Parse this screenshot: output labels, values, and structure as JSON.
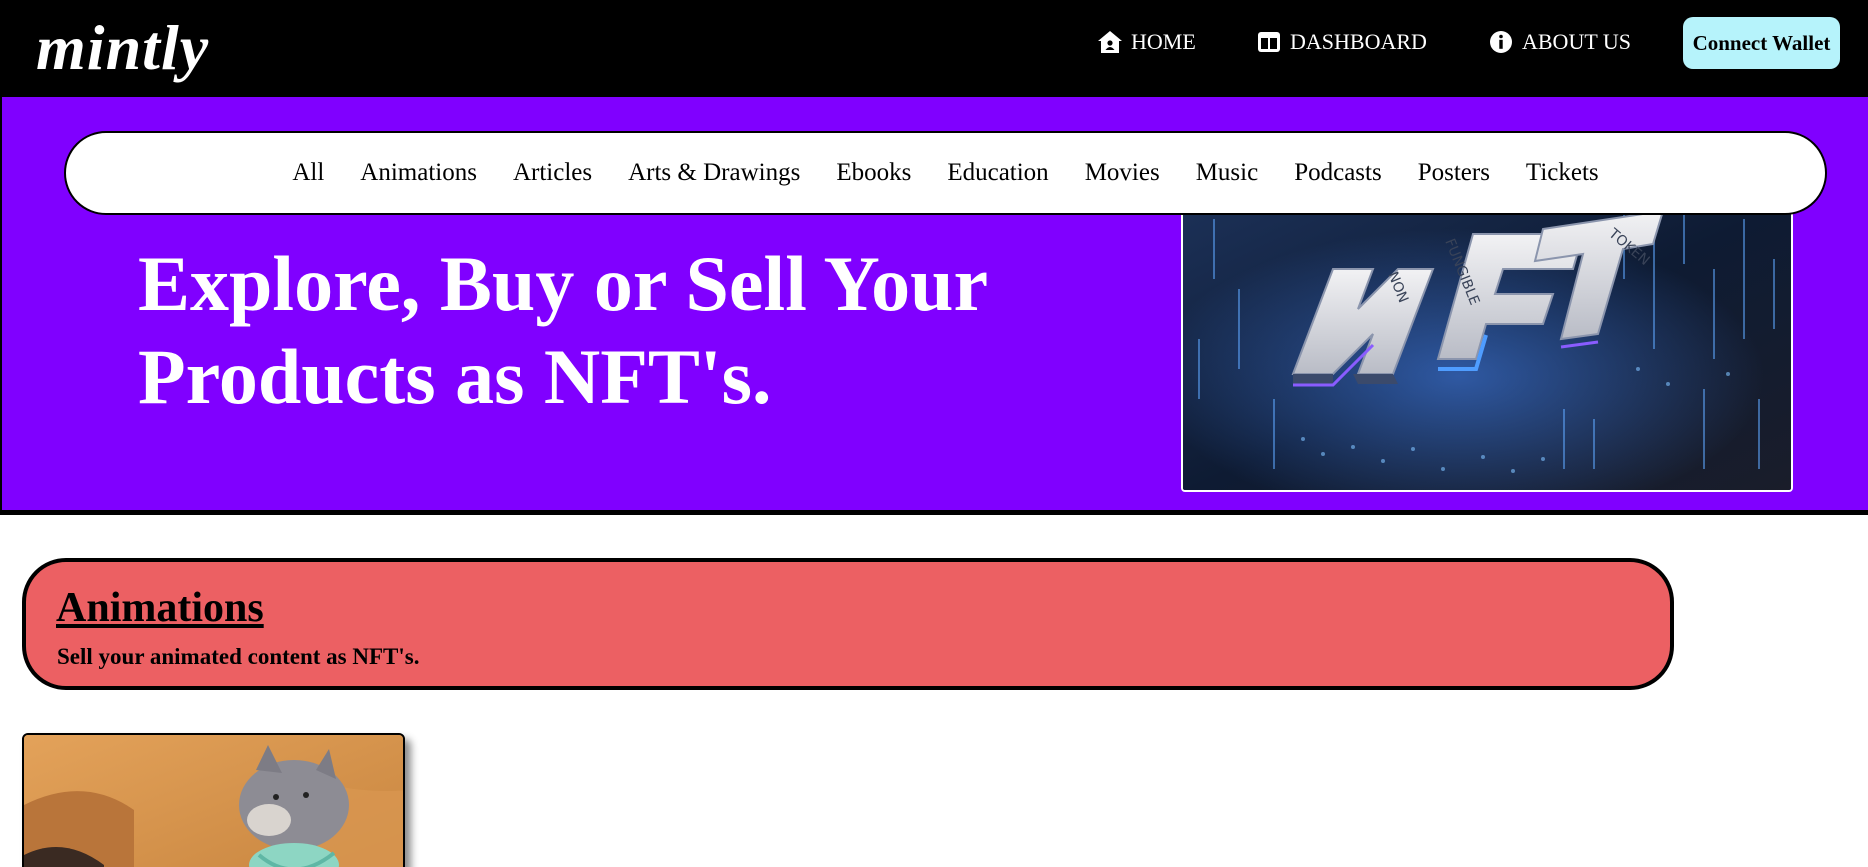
{
  "brand": {
    "logo": "mintly"
  },
  "nav": {
    "home_label": "HOME",
    "dashboard_label": "DASHBOARD",
    "about_label": "ABOUT US",
    "connect_wallet_label": "Connect Wallet",
    "icons": [
      "home-icon",
      "dashboard-icon",
      "info-icon"
    ]
  },
  "categories": [
    "All",
    "Animations",
    "Articles",
    "Arts & Drawings",
    "Ebooks",
    "Education",
    "Movies",
    "Music",
    "Podcasts",
    "Posters",
    "Tickets"
  ],
  "hero": {
    "title_line1": "Explore, Buy or Sell Your",
    "title_line2": "Products as NFT's.",
    "image": {
      "letters": "NFT",
      "label_non": "NON",
      "label_fungible": "FUNGIBLE",
      "label_token": "TOKEN"
    }
  },
  "section": {
    "title": "Animations",
    "subtitle": "Sell your animated content as NFT's."
  },
  "colors": {
    "topbar": "#000000",
    "hero": "#8000ff",
    "connect_button": "#b6f3fb",
    "section_banner": "#ec6063"
  }
}
